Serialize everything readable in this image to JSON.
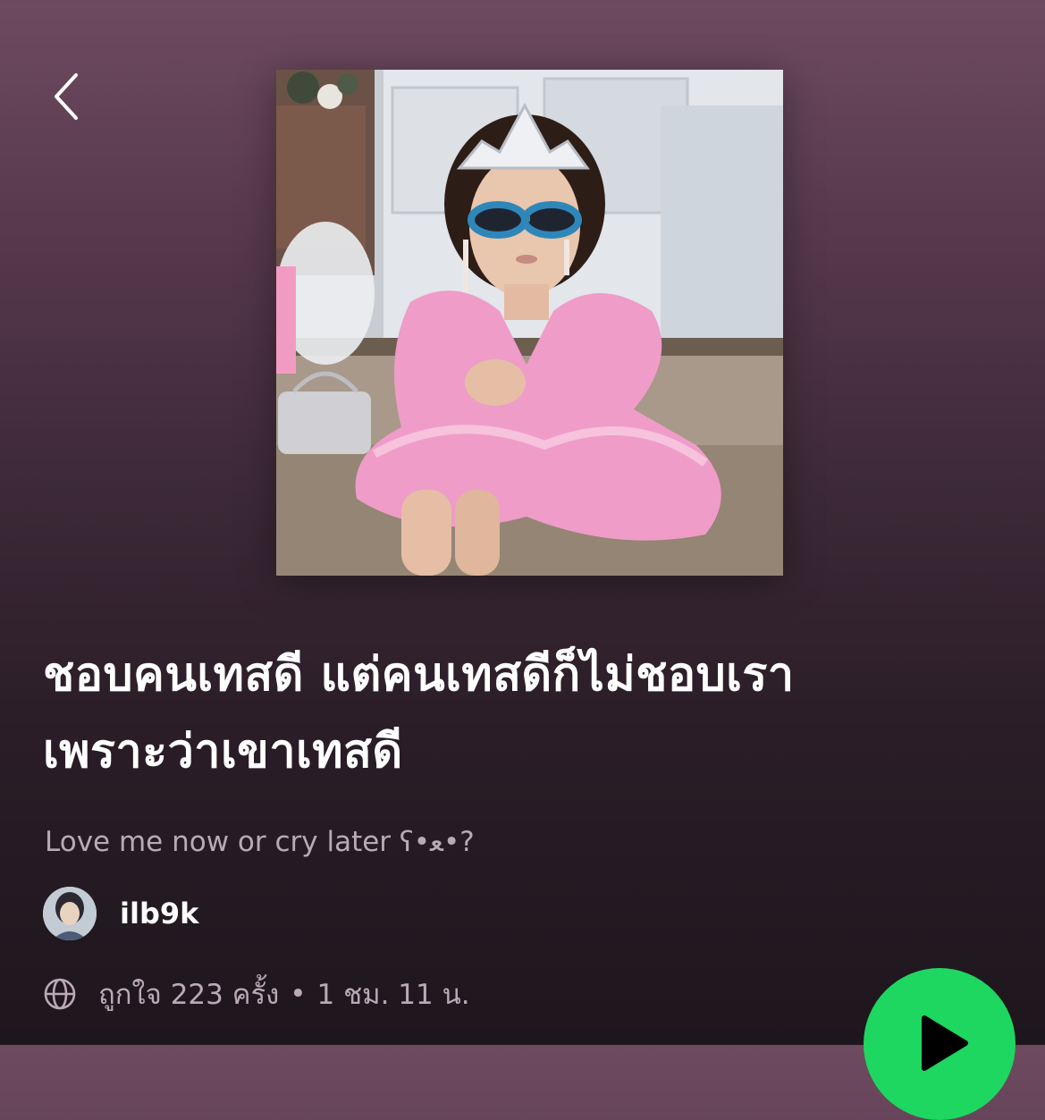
{
  "header": {
    "back_icon": "chevron-left-icon"
  },
  "playlist": {
    "title_line1": "ชอบคนเทสดี แต่คนเทสดีก็ไม่ชอบเรา",
    "title_line2": "เพราะว่าเขาเทสดี",
    "description": "Love me now or cry later ʕ•ﻌ•?",
    "owner": {
      "name": "ilb9k",
      "avatar_icon": "user-avatar"
    },
    "meta": {
      "visibility_icon": "globe-icon",
      "likes": "ถูกใจ 223 ครั้ง",
      "separator": "•",
      "duration": "1 ชม. 11 น."
    }
  },
  "controls": {
    "play_icon": "play-icon"
  },
  "colors": {
    "accent": "#1ed760",
    "secondary_text": "#b9aab5",
    "background_top": "#6e4a60",
    "background_bottom": "#1e161d"
  }
}
